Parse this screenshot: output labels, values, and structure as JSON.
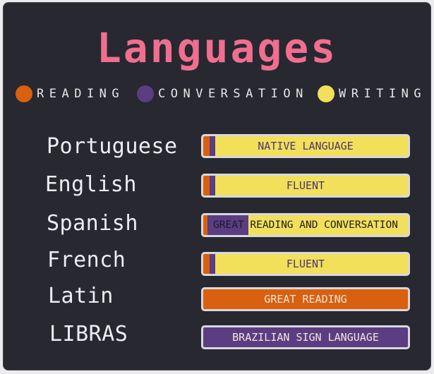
{
  "title": "Languages",
  "legend": [
    {
      "label": "READING",
      "color": "#d9600e",
      "icon": "reading-dot-icon"
    },
    {
      "label": "CONVERSATION",
      "color": "#5a3d82",
      "icon": "conversation-dot-icon"
    },
    {
      "label": "WRITING",
      "color": "#f2e05a",
      "icon": "writing-dot-icon"
    }
  ],
  "languages": [
    {
      "name": "Portuguese",
      "level": "NATIVE LANGUAGE",
      "reading": 0.03,
      "conversation": 0.03,
      "writing": 0.94
    },
    {
      "name": "English",
      "level": "FLUENT",
      "reading": 0.03,
      "conversation": 0.03,
      "writing": 0.94
    },
    {
      "name": "Spanish",
      "level": "GREAT READING AND CONVERSATION",
      "reading": 0.02,
      "conversation": 0.2,
      "writing": 0.78
    },
    {
      "name": "French",
      "level": "FLUENT",
      "reading": 0.03,
      "conversation": 0.03,
      "writing": 0.94
    },
    {
      "name": "Latin",
      "level": "GREAT READING",
      "reading": 1.0,
      "conversation": 0,
      "writing": 0
    },
    {
      "name": "LIBRAS",
      "level": "BRAZILIAN SIGN LANGUAGE",
      "reading": 0,
      "conversation": 1.0,
      "writing": 0
    }
  ]
}
